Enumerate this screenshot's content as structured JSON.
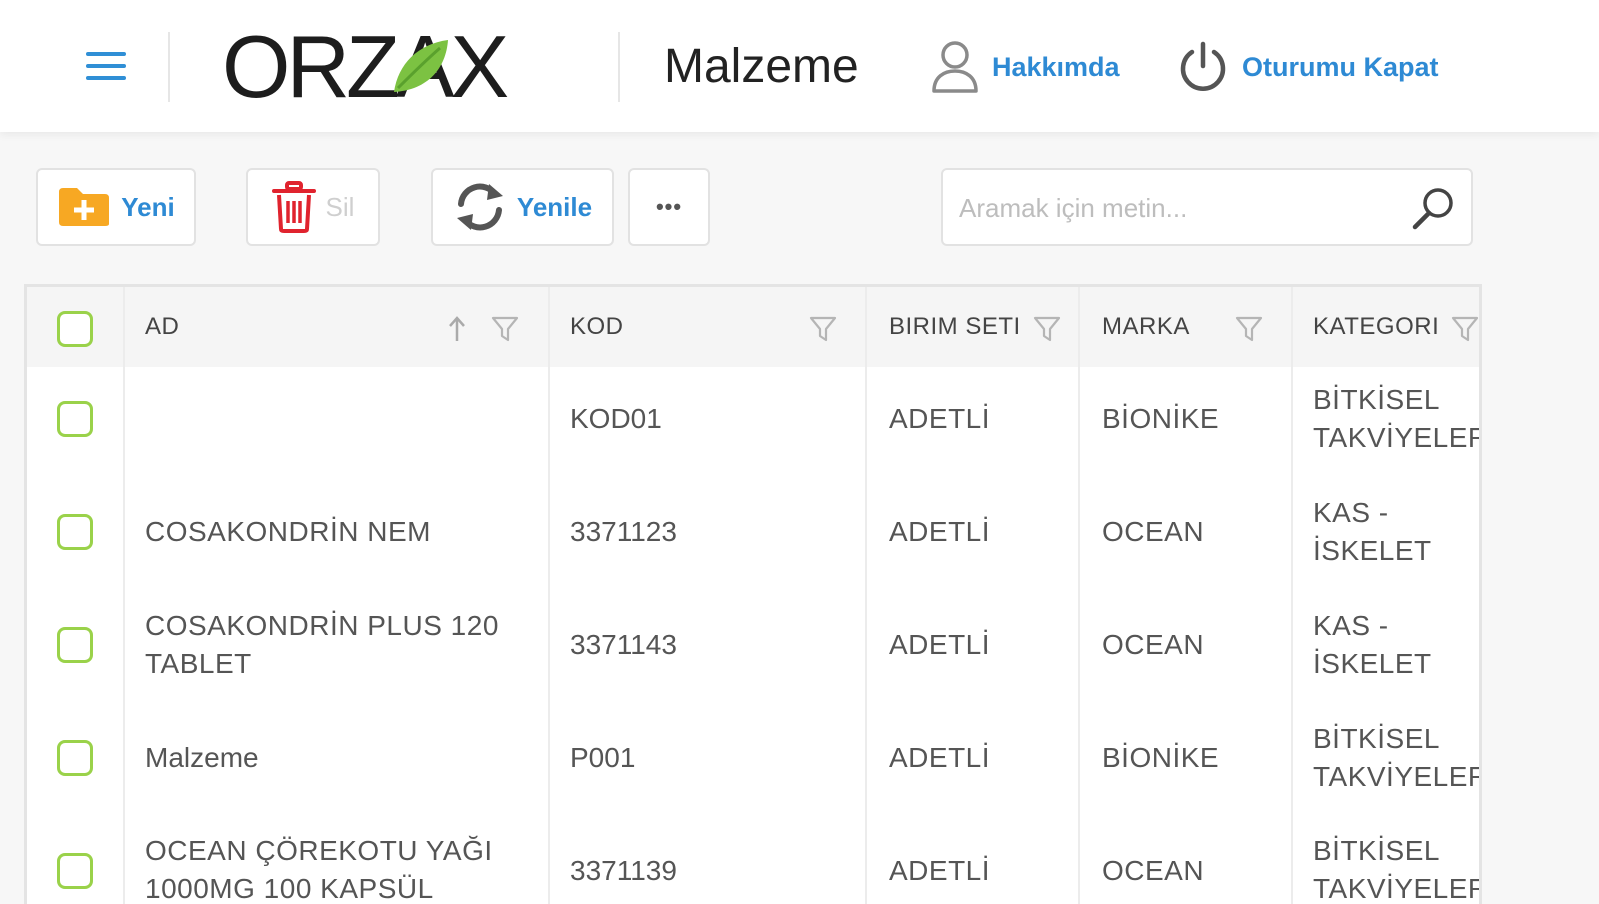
{
  "header": {
    "logo_text": "ORZAX",
    "page_title": "Malzeme",
    "about_label": "Hakkımda",
    "logout_label": "Oturumu Kapat",
    "icons": {
      "menu": "hamburger-menu-icon",
      "about": "user-icon",
      "logout": "power-icon"
    }
  },
  "toolbar": {
    "new_label": "Yeni",
    "delete_label": "Sil",
    "refresh_label": "Yenile",
    "more_label": "•••",
    "search_placeholder": "Aramak için metin..."
  },
  "colors": {
    "accent": "#2e8ad4",
    "checkbox": "#9ad24a",
    "new_icon": "#f7a823",
    "delete_icon": "#e0232e",
    "logo_leaf": "#7cc242"
  },
  "table": {
    "columns": [
      "AD",
      "KOD",
      "BIRIM SETI",
      "MARKA",
      "KATEGORI"
    ],
    "rows": [
      {
        "ad": [
          "",
          ""
        ],
        "kod": "KOD01",
        "birim": "ADETLİ",
        "marka": "BİONİKE",
        "kategori": [
          "BİTKİSEL",
          "TAKVİYELER"
        ]
      },
      {
        "ad": [
          "COSAKONDRİN NEM",
          ""
        ],
        "kod": "3371123",
        "birim": "ADETLİ",
        "marka": "OCEAN",
        "kategori": [
          "KAS -",
          "İSKELET"
        ]
      },
      {
        "ad": [
          "COSAKONDRİN PLUS 120",
          "TABLET"
        ],
        "kod": "3371143",
        "birim": "ADETLİ",
        "marka": "OCEAN",
        "kategori": [
          "KAS -",
          "İSKELET"
        ]
      },
      {
        "ad": [
          "Malzeme",
          ""
        ],
        "kod": "P001",
        "birim": "ADETLİ",
        "marka": "BİONİKE",
        "kategori": [
          "BİTKİSEL",
          "TAKVİYELER"
        ]
      },
      {
        "ad": [
          "OCEAN ÇÖREKOTU YAĞI",
          "1000MG 100 KAPSÜL"
        ],
        "kod": "3371139",
        "birim": "ADETLİ",
        "marka": "OCEAN",
        "kategori": [
          "BİTKİSEL",
          "TAKVİYELER"
        ]
      }
    ]
  }
}
